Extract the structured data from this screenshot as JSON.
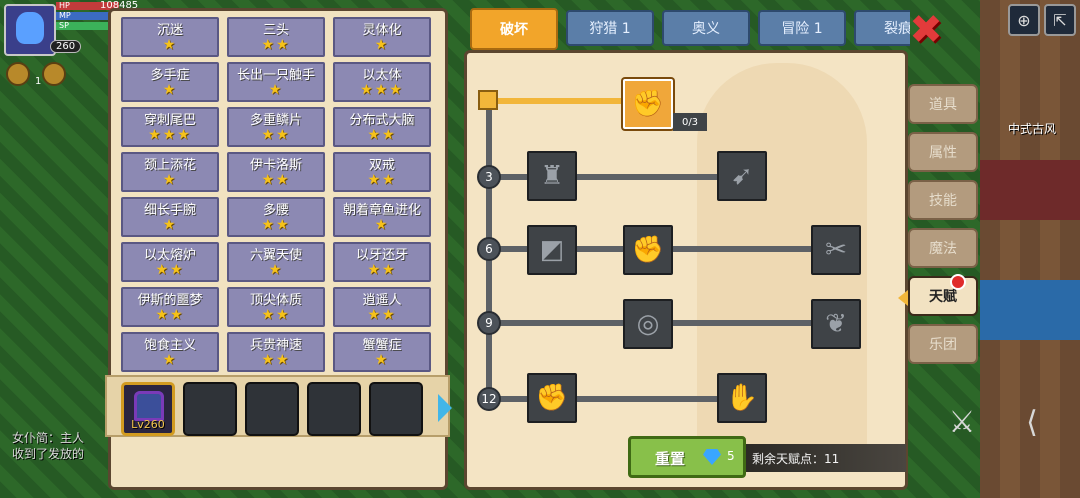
{
  "status": {
    "hp": "108485",
    "hp_label": "HP",
    "mp_label": "MP",
    "sp_label": "SP",
    "level": "260",
    "skill_count": "1"
  },
  "chat": {
    "line1": "女仆简：主人",
    "line2": "收到了发放的"
  },
  "traits": [
    {
      "name": "沉迷",
      "stars": "★"
    },
    {
      "name": "三头",
      "stars": "★★"
    },
    {
      "name": "灵体化",
      "stars": "★"
    },
    {
      "name": "多手症",
      "stars": "★"
    },
    {
      "name": "长出一只触手",
      "stars": "★"
    },
    {
      "name": "以太体",
      "stars": "★★★"
    },
    {
      "name": "穿刺尾巴",
      "stars": "★★★"
    },
    {
      "name": "多重鳞片",
      "stars": "★★"
    },
    {
      "name": "分布式大脑",
      "stars": "★★"
    },
    {
      "name": "颈上添花",
      "stars": "★"
    },
    {
      "name": "伊卡洛斯",
      "stars": "★★"
    },
    {
      "name": "双戒",
      "stars": "★★"
    },
    {
      "name": "细长手腕",
      "stars": "★"
    },
    {
      "name": "多腰",
      "stars": "★★"
    },
    {
      "name": "朝着章鱼进化",
      "stars": "★"
    },
    {
      "name": "以太熔炉",
      "stars": "★★"
    },
    {
      "name": "六翼天使",
      "stars": "★"
    },
    {
      "name": "以牙还牙",
      "stars": "★★"
    },
    {
      "name": "伊斯的噩梦",
      "stars": "★★"
    },
    {
      "name": "顶尖体质",
      "stars": "★★"
    },
    {
      "name": "逍遥人",
      "stars": "★★"
    },
    {
      "name": "饱食主义",
      "stars": "★"
    },
    {
      "name": "兵贵神速",
      "stars": "★★"
    },
    {
      "name": "蟹蟹症",
      "stars": "★"
    }
  ],
  "slots": {
    "selected_level": "Lv260"
  },
  "tabs": [
    "破坏",
    "狩猎 1",
    "奥义",
    "冒险 1",
    "裂痕"
  ],
  "tree": {
    "root_count": "0/3",
    "tiers": [
      "3",
      "6",
      "9",
      "12"
    ]
  },
  "reset": {
    "label": "重置",
    "gems": "5"
  },
  "remaining": "剩余天赋点：11",
  "side_tabs": [
    "道具",
    "属性",
    "技能",
    "魔法",
    "天赋",
    "乐团"
  ],
  "map_label": "中式古风",
  "colors": {
    "accent": "#f2a52a",
    "tab_blue": "#5b7ea8",
    "star": "#f6c21a"
  }
}
